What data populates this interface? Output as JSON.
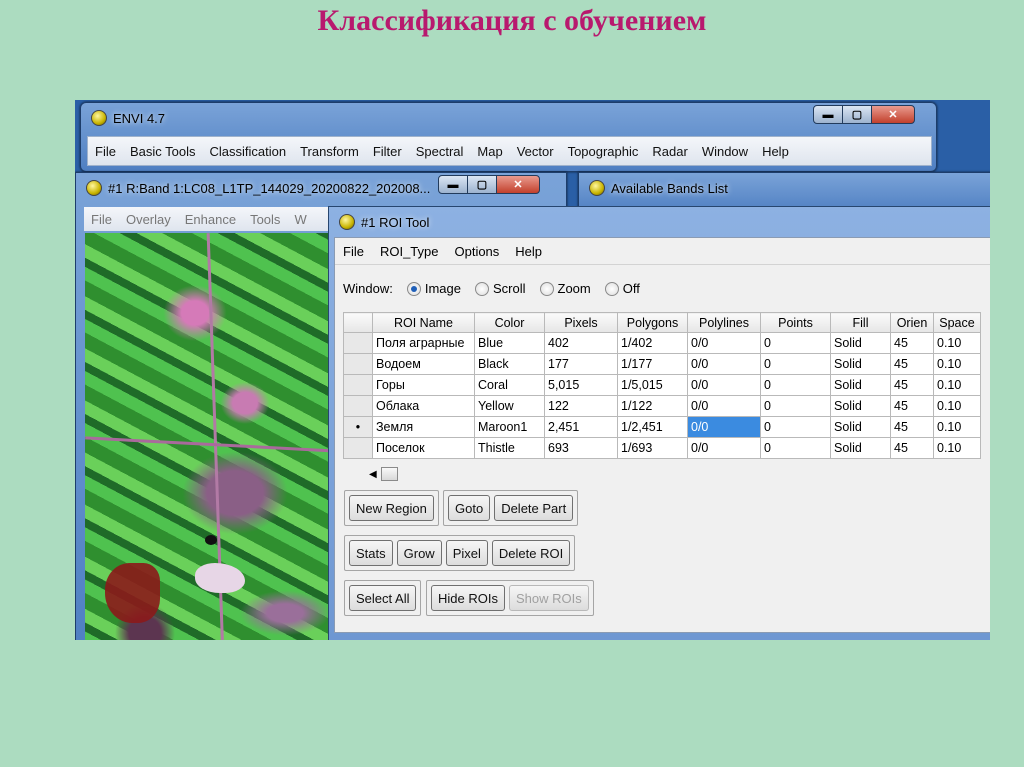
{
  "slide_title": "Классификация с обучением",
  "envi": {
    "title": "ENVI 4.7",
    "menu": [
      "File",
      "Basic Tools",
      "Classification",
      "Transform",
      "Filter",
      "Spectral",
      "Map",
      "Vector",
      "Topographic",
      "Radar",
      "Window",
      "Help"
    ]
  },
  "band_window": {
    "title": "#1 R:Band 1:LC08_L1TP_144029_20200822_202008...",
    "menu": [
      "File",
      "Overlay",
      "Enhance",
      "Tools",
      "W"
    ]
  },
  "bands_list": {
    "title": "Available Bands List"
  },
  "roi_tool": {
    "title": "#1 ROI Tool",
    "menu": [
      "File",
      "ROI_Type",
      "Options",
      "Help"
    ],
    "window_label": "Window:",
    "window_options": [
      "Image",
      "Scroll",
      "Zoom",
      "Off"
    ],
    "window_selected": "Image",
    "columns": [
      "ROI Name",
      "Color",
      "Pixels",
      "Polygons",
      "Polylines",
      "Points",
      "Fill",
      "Orien",
      "Space"
    ],
    "rows": [
      {
        "marker": "",
        "name": "Поля аграрные",
        "color": "Blue",
        "pixels": "402",
        "polygons": "1/402",
        "polylines": "0/0",
        "points": "0",
        "fill": "Solid",
        "orien": "45",
        "space": "0.10"
      },
      {
        "marker": "",
        "name": "Водоем",
        "color": "Black",
        "pixels": "177",
        "polygons": "1/177",
        "polylines": "0/0",
        "points": "0",
        "fill": "Solid",
        "orien": "45",
        "space": "0.10"
      },
      {
        "marker": "",
        "name": "Горы",
        "color": "Coral",
        "pixels": "5,015",
        "polygons": "1/5,015",
        "polylines": "0/0",
        "points": "0",
        "fill": "Solid",
        "orien": "45",
        "space": "0.10"
      },
      {
        "marker": "",
        "name": "Облака",
        "color": "Yellow",
        "pixels": "122",
        "polygons": "1/122",
        "polylines": "0/0",
        "points": "0",
        "fill": "Solid",
        "orien": "45",
        "space": "0.10"
      },
      {
        "marker": "•",
        "name": "Земля",
        "color": "Maroon1",
        "pixels": "2,451",
        "polygons": "1/2,451",
        "polylines": "0/0",
        "points": "0",
        "fill": "Solid",
        "orien": "45",
        "space": "0.10"
      },
      {
        "marker": "",
        "name": "Поселок",
        "color": "Thistle",
        "pixels": "693",
        "polygons": "1/693",
        "polylines": "0/0",
        "points": "0",
        "fill": "Solid",
        "orien": "45",
        "space": "0.10"
      }
    ],
    "buttons": {
      "new_region": "New Region",
      "goto": "Goto",
      "delete_part": "Delete Part",
      "stats": "Stats",
      "grow": "Grow",
      "pixel": "Pixel",
      "delete_roi": "Delete ROI",
      "select_all": "Select All",
      "hide_rois": "Hide ROIs",
      "show_rois": "Show ROIs"
    }
  }
}
